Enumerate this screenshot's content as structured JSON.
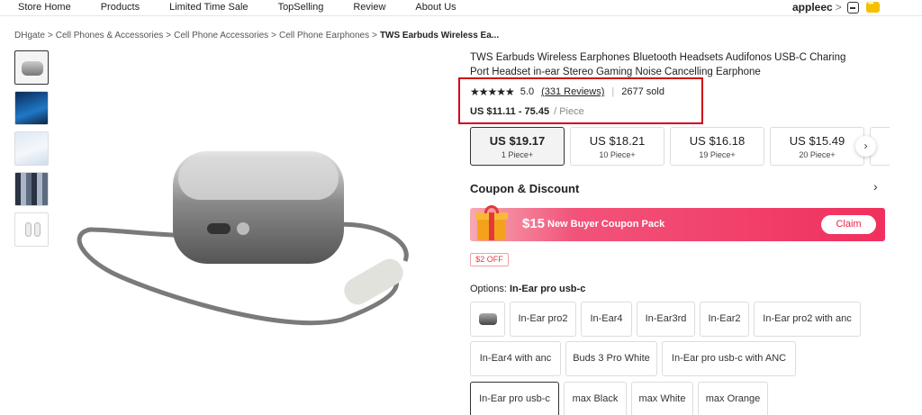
{
  "nav": {
    "links": [
      "Store Home",
      "Products",
      "Limited Time Sale",
      "TopSelling",
      "Review",
      "About Us"
    ],
    "username": "appleec",
    "user_chevron": ">"
  },
  "breadcrumb": {
    "items": [
      "DHgate",
      "Cell Phones & Accessories",
      "Cell Phone Accessories",
      "Cell Phone Earphones"
    ],
    "separator": ">",
    "current": "TWS Earbuds Wireless Ea..."
  },
  "product": {
    "title": "TWS Earbuds Wireless Earphones Bluetooth Headsets Audifonos USB-C Charing Port Headset in-ear Stereo Gaming Noise Cancelling Earphone",
    "stars": "★★★★★",
    "rating": "5.0",
    "reviews": "(331 Reviews)",
    "divider": "|",
    "sold": "2677 sold",
    "price_range": "US $11.11 - 75.45",
    "price_unit": "/ Piece",
    "highlight_color": "#d0021b"
  },
  "price_tiers": [
    {
      "price": "US $19.17",
      "qty": "1 Piece+"
    },
    {
      "price": "US $18.21",
      "qty": "10 Piece+"
    },
    {
      "price": "US $16.18",
      "qty": "19 Piece+"
    },
    {
      "price": "US $15.49",
      "qty": "20 Piece+"
    }
  ],
  "tiers_next_icon": "›",
  "coupon": {
    "heading": "Coupon & Discount",
    "chevron": "›",
    "amount": "$15",
    "text": "New Buyer Coupon Pack",
    "claim": "Claim",
    "badge": "$2 OFF",
    "accent_color": "#f0305e"
  },
  "options": {
    "label": "Options:",
    "selected": "In-Ear pro usb-c",
    "items": [
      "In-Ear pro2",
      "In-Ear4",
      "In-Ear3rd",
      "In-Ear2",
      "In-Ear pro2 with anc",
      "In-Ear4 with anc",
      "Buds 3 Pro White",
      "In-Ear pro usb-c with ANC",
      "In-Ear pro usb-c",
      "max Black",
      "max White",
      "max Orange"
    ]
  }
}
